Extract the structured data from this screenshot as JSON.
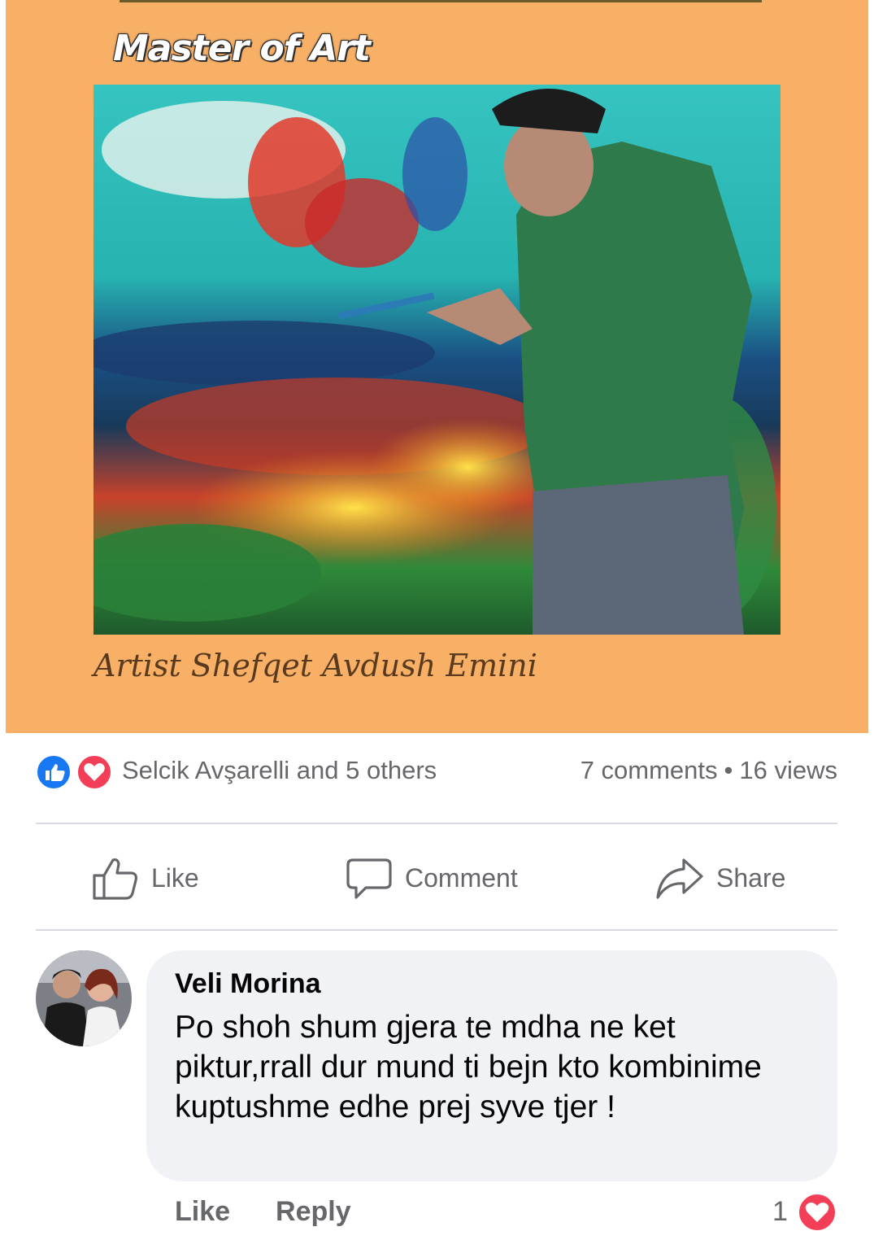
{
  "post": {
    "brand_title": "Master of Art",
    "caption": "Artist Shefqet Avdush Emini",
    "colors": {
      "poster_background": "#f8b066"
    }
  },
  "reactions": {
    "icons": [
      "like-icon",
      "love-icon"
    ],
    "names": "Selcik Avşarelli and 5 others",
    "comments": "7 comments",
    "separator": "•",
    "views": "16 views"
  },
  "actions": {
    "like": "Like",
    "comment": "Comment",
    "share": "Share"
  },
  "comment": {
    "author": "Veli Morina",
    "text": "Po shoh shum gjera te mdha ne ket piktur,rrall dur mund ti bejn kto kombinime kuptushme edhe prej syve tjer !",
    "like": "Like",
    "reply": "Reply",
    "reaction_count": "1",
    "reaction_icon": "love-icon"
  },
  "colors": {
    "like_blue": "#1877f2",
    "love_red": "#f33e58",
    "secondary_text": "#65676b",
    "bubble_bg": "#f0f2f5"
  }
}
